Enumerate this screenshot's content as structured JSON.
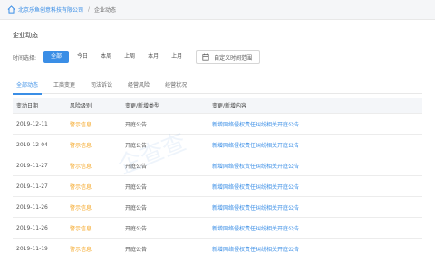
{
  "breadcrumb": {
    "company": "北京乐鱼创意科技有限公司",
    "separator": "/",
    "current": "企业动态"
  },
  "page_title": "企业动态",
  "filter": {
    "label": "时间选择:",
    "options": [
      "全部",
      "今日",
      "本周",
      "上周",
      "本月",
      "上月"
    ],
    "active": "全部",
    "custom_range_label": "自定义时间范围"
  },
  "tabs": {
    "items": [
      "全部动态",
      "工商变更",
      "司法诉讼",
      "经营风险",
      "经营状况"
    ],
    "active": "全部动态"
  },
  "table": {
    "headers": [
      "变动日期",
      "风险级别",
      "变更/新增类型",
      "变更/新增内容"
    ],
    "rows": [
      {
        "date": "2019-12-11",
        "level": "警示信息",
        "type": "开庭公告",
        "content": "新增网络侵权责任纠纷相关开庭公告"
      },
      {
        "date": "2019-12-04",
        "level": "警示信息",
        "type": "开庭公告",
        "content": "新增网络侵权责任纠纷相关开庭公告"
      },
      {
        "date": "2019-11-27",
        "level": "警示信息",
        "type": "开庭公告",
        "content": "新增网络侵权责任纠纷相关开庭公告"
      },
      {
        "date": "2019-11-27",
        "level": "警示信息",
        "type": "开庭公告",
        "content": "新增网络侵权责任纠纷相关开庭公告"
      },
      {
        "date": "2019-11-26",
        "level": "警示信息",
        "type": "开庭公告",
        "content": "新增网络侵权责任纠纷相关开庭公告"
      },
      {
        "date": "2019-11-26",
        "level": "警示信息",
        "type": "开庭公告",
        "content": "新增网络侵权责任纠纷相关开庭公告"
      },
      {
        "date": "2019-11-19",
        "level": "警示信息",
        "type": "开庭公告",
        "content": "新增网络侵权责任纠纷相关开庭公告"
      }
    ]
  },
  "watermark": "企查查",
  "colors": {
    "accent": "#3a8ee6",
    "warning": "#f5a623"
  }
}
